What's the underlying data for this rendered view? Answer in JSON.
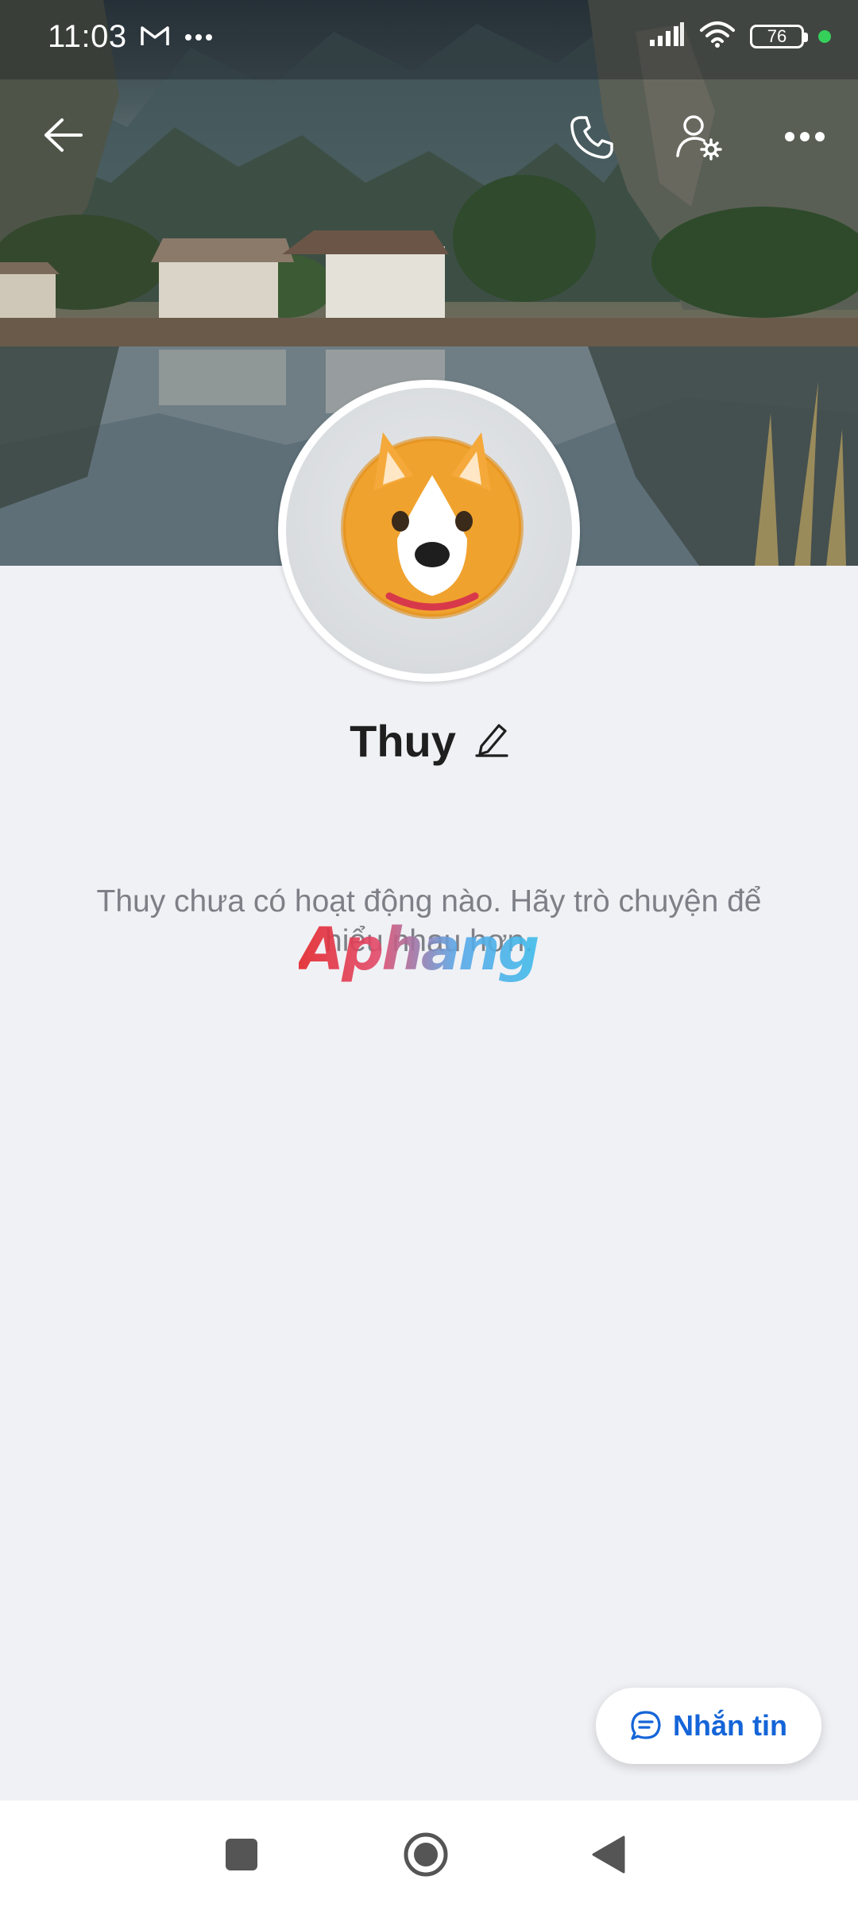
{
  "status_bar": {
    "time": "11:03",
    "battery_level": "76",
    "notification_icons": [
      "gmail-icon",
      "more-notifications-icon"
    ],
    "system_icons": [
      "signal-icon",
      "wifi-icon",
      "battery-icon",
      "charging-dot-icon"
    ]
  },
  "header": {
    "icons": [
      "back-arrow-icon",
      "phone-call-icon",
      "user-settings-icon",
      "more-options-icon"
    ]
  },
  "profile": {
    "name": "Thuy",
    "avatar_icon": "corgi-avatar",
    "edit_icon": "pencil-edit-icon"
  },
  "feed": {
    "empty_message": "Thuy chưa có hoạt động nào. Hãy trò chuyện để hiểu nhau hơn."
  },
  "watermark": {
    "text": "Aphang"
  },
  "actions": {
    "message_button_label": "Nhắn tin",
    "message_icon": "chat-bubble-icon"
  },
  "nav_bar": {
    "icons": [
      "recents-square-icon",
      "home-circle-icon",
      "back-triangle-icon"
    ]
  },
  "colors": {
    "accent": "#1565d8",
    "background": "#f0f1f5",
    "muted_text": "#7d8086",
    "charging": "#35d05a"
  }
}
